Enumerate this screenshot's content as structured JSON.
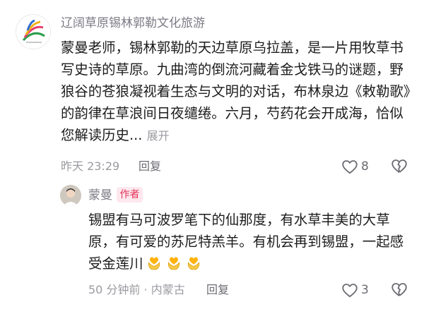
{
  "comment": {
    "author": "辽阔草原锡林郭勒文化旅游",
    "text": "蒙曼老师，锡林郭勒的天边草原乌拉盖，是一片用牧草书写史诗的草原。九曲湾的倒流河藏着金戈铁马的谜题，野狼谷的苍狼凝视着生态与文明的对话，布林泉边《敕勒歌》的韵律在草浪间日夜缱绻。六月，芍药花会开成海，恰似您解读历史...",
    "expand_label": "展开",
    "time": "昨天 23:29",
    "reply_label": "回复",
    "like_count": "8",
    "avatar_icon": "grassland-logo-avatar"
  },
  "reply": {
    "author": "蒙曼",
    "badge": "作者",
    "text": "锡盟有马可波罗笔下的仙那度，有水草丰美的大草原，有可爱的苏尼特羔羊。有机会再到锡盟，一起感受金莲川",
    "emoji_names": [
      "heart-hands-emoji",
      "heart-hands-emoji",
      "heart-hands-emoji"
    ],
    "time": "50 分钟前 · 内蒙古",
    "reply_label": "回复",
    "like_count": "3"
  },
  "colors": {
    "secondary_text": "#9a9aa0",
    "badge_bg": "#fde8ee",
    "badge_text": "#e5335a",
    "icon": "#6b6b72"
  }
}
